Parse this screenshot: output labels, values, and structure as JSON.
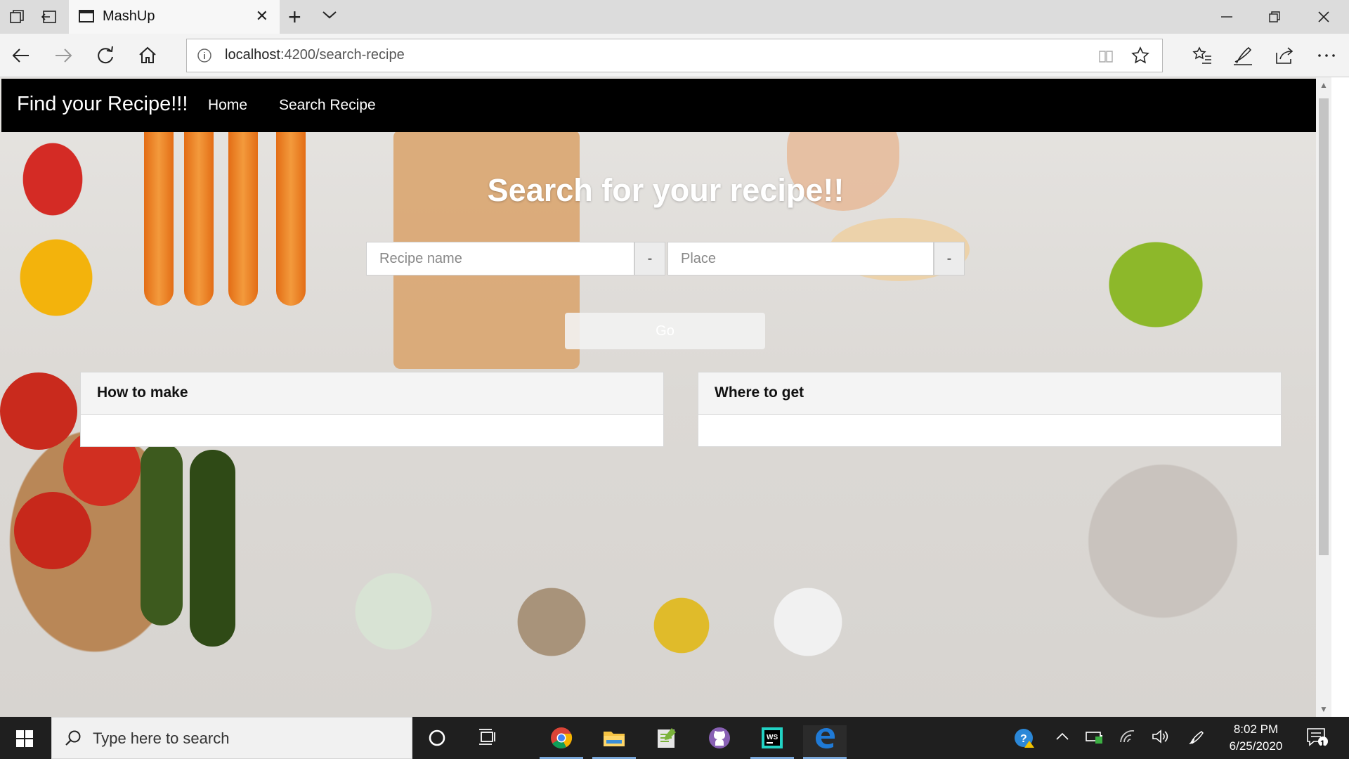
{
  "browser": {
    "tab_title": "MashUp",
    "url_host": "localhost",
    "url_path": ":4200/search-recipe"
  },
  "page": {
    "brand": "Find your Recipe!!!",
    "nav": [
      {
        "label": "Home"
      },
      {
        "label": "Search Recipe"
      }
    ],
    "hero_title": "Search for your recipe!!",
    "recipe_placeholder": "Recipe name",
    "recipe_addon": "-",
    "place_placeholder": "Place",
    "place_addon": "-",
    "go_label": "Go",
    "cards": [
      {
        "title": "How to make"
      },
      {
        "title": "Where to get"
      }
    ]
  },
  "taskbar": {
    "search_placeholder": "Type here to search",
    "time": "8:02 PM",
    "date": "6/25/2020",
    "notification_count": "1"
  },
  "colors": {
    "navbar": "#000000",
    "taskbar": "#1f1f1f",
    "edge_blue": "#1f7ad6"
  }
}
